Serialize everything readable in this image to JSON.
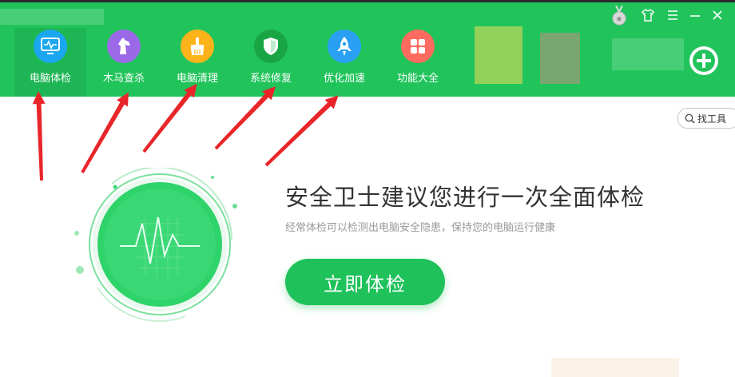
{
  "nav": {
    "items": [
      {
        "label": "电脑体检",
        "icon": "monitor-pulse-icon",
        "color": "#1aa7f0"
      },
      {
        "label": "木马查杀",
        "icon": "horse-icon",
        "color": "#9b68e8"
      },
      {
        "label": "电脑清理",
        "icon": "broom-icon",
        "color": "#ffb31a"
      },
      {
        "label": "系统修复",
        "icon": "shield-icon",
        "color": "#1aa545"
      },
      {
        "label": "优化加速",
        "icon": "rocket-icon",
        "color": "#2aa0f5"
      },
      {
        "label": "功能大全",
        "icon": "grid-icon",
        "color": "#ff6b5e"
      }
    ],
    "active_index": 0
  },
  "window_controls": {
    "skin": "shirt-icon",
    "menu": "menu-icon",
    "minimize": "minimize-icon",
    "close": "close-icon",
    "medal": "medal-icon",
    "add": "add-icon"
  },
  "search": {
    "label": "找工具"
  },
  "main": {
    "headline": "安全卫士建议您进行一次全面体检",
    "subline": "经常体检可以检测出电脑安全隐患，保持您的电脑运行健康",
    "button_label": "立即体检"
  },
  "colors": {
    "topbar": "#21c45b",
    "accent": "#1fc15a",
    "arrow": "#e8262a"
  }
}
